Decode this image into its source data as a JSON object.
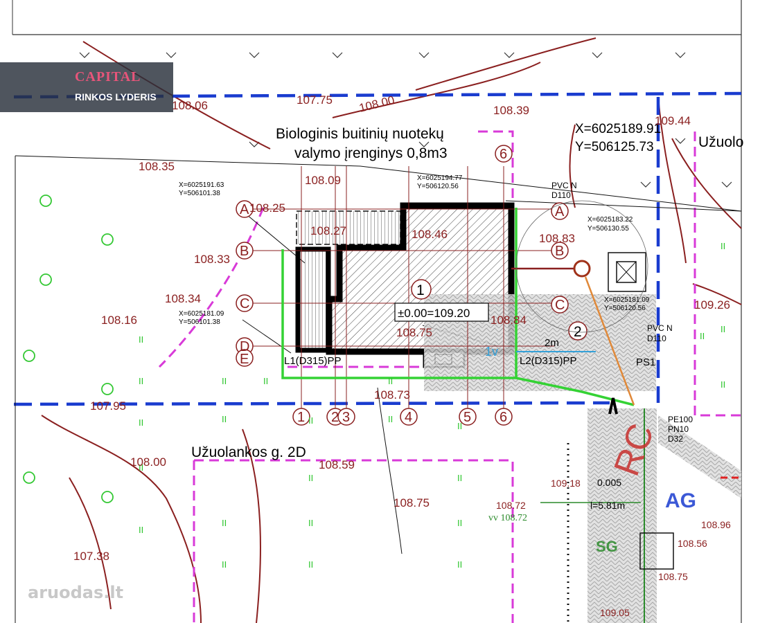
{
  "logo": {
    "brand": "CAPITAL",
    "tagline": "RINKOS LYDERIS"
  },
  "watermark": "aruodas.lt",
  "title_line1": "Biologinis buitinių nuotekų",
  "title_line2": "valymo įrenginys 0,8m3",
  "street_label": "Užuolankos g. 2D",
  "street_label_right": "Užuolo",
  "coords": {
    "top_right_x": "X=6025189.91",
    "top_right_y": "Y=506125.73",
    "c1x": "X=6025191.63",
    "c1y": "Y=506101.38",
    "c2x": "X=6025194.77",
    "c2y": "Y=506120.56",
    "c3x": "X=6025183.22",
    "c3y": "Y=506130.55",
    "c4x": "X=6025181.09",
    "c4y": "Y=506101.38",
    "c5x": "X=6025181.09",
    "c5y": "Y=506120.56"
  },
  "elevations": [
    "108.06",
    "107.75",
    "108.00",
    "108.39",
    "109.44",
    "108.35",
    "108.09",
    "108.25",
    "108.27",
    "108.46",
    "108.33",
    "108.34",
    "108.16",
    "108.75",
    "108.84",
    "108.83",
    "109.26",
    "107.95",
    "108.73",
    "108.59",
    "108.00",
    "108.75",
    "107.38",
    "109.18",
    "108.72",
    "108.96",
    "108.56",
    "109.05",
    "108.75"
  ],
  "axis_letters": [
    "A",
    "B",
    "C",
    "D",
    "E"
  ],
  "axis_numbers": [
    "1",
    "2",
    "3",
    "4",
    "5",
    "6"
  ],
  "building_no": "1",
  "building_zero": "±0.00=109.20",
  "second_no": "2",
  "pipes": {
    "pvc1": "PVC N",
    "pvc1d": "D110",
    "pvc2": "PVC N",
    "pvc2d": "D110",
    "l1": "L1(D315)PP",
    "l2": "L2(D315)PP",
    "ps1": "PS1",
    "pe": "PE100",
    "pn": "PN10",
    "d32": "D32",
    "vv": "vv 108.72",
    "lv": "1v",
    "dist": "2m",
    "slope": "0.005",
    "grade": "l=5.81m"
  },
  "colors": {
    "blue": "#1a3ccf",
    "magenta": "#d83ad8",
    "green": "#34d234",
    "brown": "#8a1f1f"
  }
}
